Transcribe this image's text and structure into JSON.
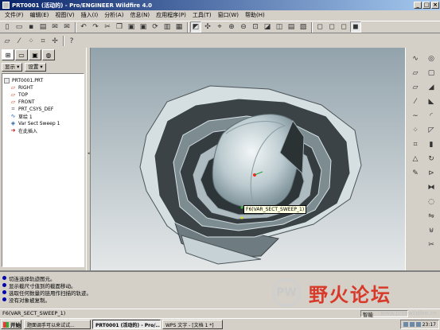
{
  "window": {
    "title": "PRT0001 (活动的) - Pro/ENGINEER Wildfire 4.0"
  },
  "menu": [
    "文件(F)",
    "编辑(E)",
    "视图(V)",
    "插入(I)",
    "分析(A)",
    "信息(N)",
    "应用程序(P)",
    "工具(T)",
    "窗口(W)",
    "帮助(H)"
  ],
  "tree": {
    "show_label": "显示 ▾",
    "settings_label": "设置 ▾",
    "root": "PRT0001.PRT",
    "items": [
      "RIGHT",
      "TOP",
      "FRONT",
      "PRT_CSYS_DEF",
      "草绘 1",
      "Var Sect Sweep 1",
      "在此插入"
    ]
  },
  "tooltip": "F6(VAR_SECT_SWEEP_1)",
  "messages": [
    "切连选择轨迹图元。",
    "显示截尺寸值到的截面移动。",
    "选取任何数量的链用作扫描的轨迹。",
    "没有对象被复制。"
  ],
  "status": "F6(VAR_SECT_SWEEP_1)",
  "status_field": "智能",
  "watermark": {
    "logo_text": "PW",
    "text": "野火论坛",
    "url": "www.proewildfire.cn"
  },
  "taskbar": {
    "start": "开始",
    "tasks": [
      "题面调手可以来试试...",
      "PRT0001 (活动的) - Pro/...",
      "WPS 文字 - [文档 1 *]"
    ],
    "clock": "23:17"
  },
  "colors": {
    "titlebar": "#0a246a",
    "model_dark": "#3b4347",
    "model_light": "#d8e4e8"
  }
}
